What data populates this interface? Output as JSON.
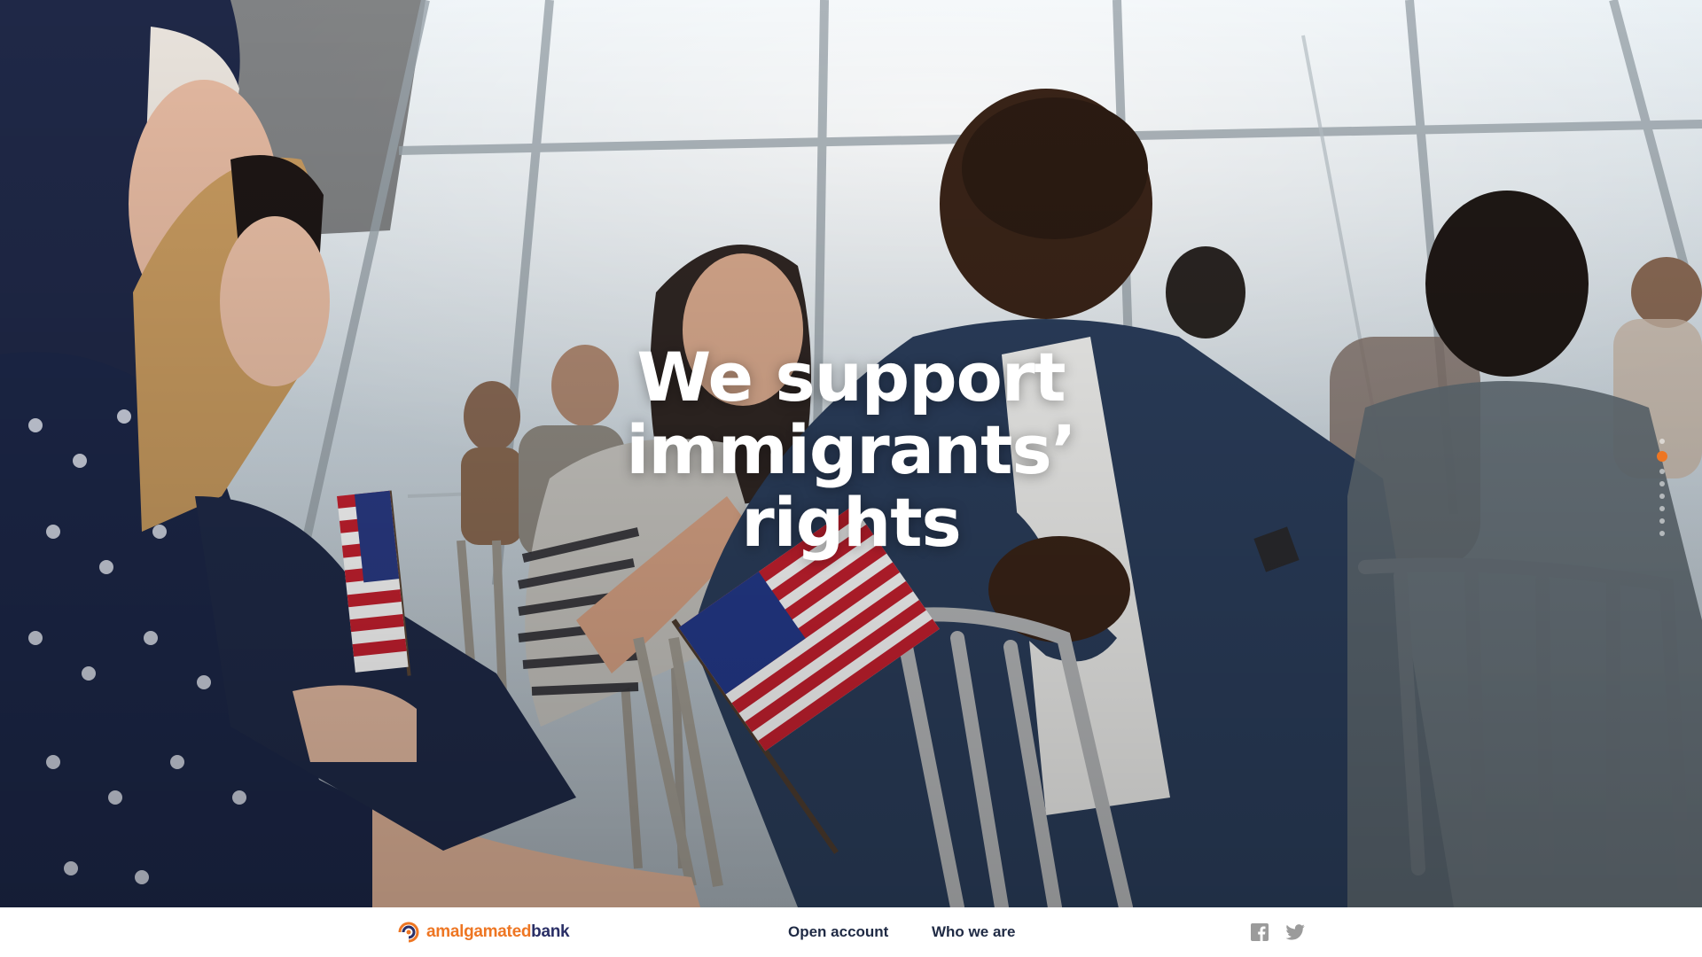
{
  "hero": {
    "headline_lines": [
      "We support",
      "immigrants’",
      "rights"
    ],
    "slides": {
      "count": 8,
      "active_index": 1
    }
  },
  "footer": {
    "logo": {
      "word1": "amalgamated",
      "word2": "bank"
    },
    "nav": {
      "open_account": "Open account",
      "who_we_are": "Who we are"
    },
    "social": [
      "facebook-icon",
      "twitter-icon"
    ]
  },
  "colors": {
    "accent_orange": "#ee7623",
    "brand_navy": "#2a2f66",
    "nav_text": "#1f2a44",
    "headline_text": "#ffffff"
  }
}
